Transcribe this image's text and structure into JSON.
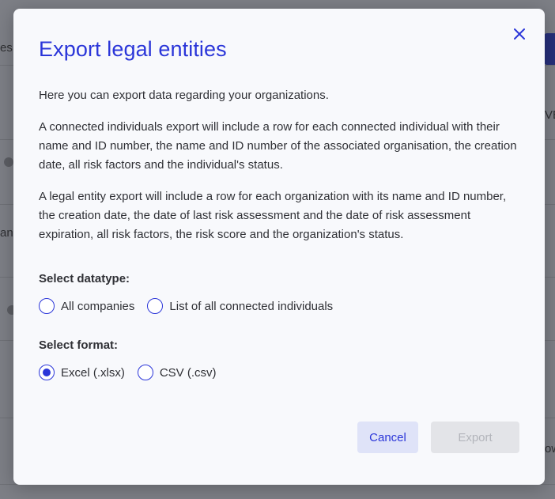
{
  "background": {
    "fragments": [
      "es.",
      "VE",
      "an",
      "ow"
    ]
  },
  "dialog": {
    "title": "Export legal entities",
    "intro": "Here you can export data regarding your organizations.",
    "connected_desc": "A connected individuals export will include a row for each connected individual with their name and ID number, the name and ID number of the associated organisation, the creation date, all risk factors and the individual's status.",
    "legal_desc": "A legal entity export will include a row for each organization with its name and ID number, the creation date, the date of last risk assessment and the date of risk assessment expiration, all risk factors, the risk score and the organization's status.",
    "datatype": {
      "label": "Select datatype:",
      "options": [
        {
          "label": "All companies",
          "selected": false
        },
        {
          "label": "List of all connected individuals",
          "selected": false
        }
      ]
    },
    "format": {
      "label": "Select format:",
      "options": [
        {
          "label": "Excel (.xlsx)",
          "selected": true
        },
        {
          "label": "CSV (.csv)",
          "selected": false
        }
      ]
    },
    "buttons": {
      "cancel": "Cancel",
      "export": "Export",
      "export_disabled": true
    },
    "icons": {
      "close": "close-icon"
    },
    "colors": {
      "accent": "#2b36d9",
      "cancel_bg": "#dfe3f8",
      "export_disabled_bg": "#e3e4e8"
    }
  }
}
